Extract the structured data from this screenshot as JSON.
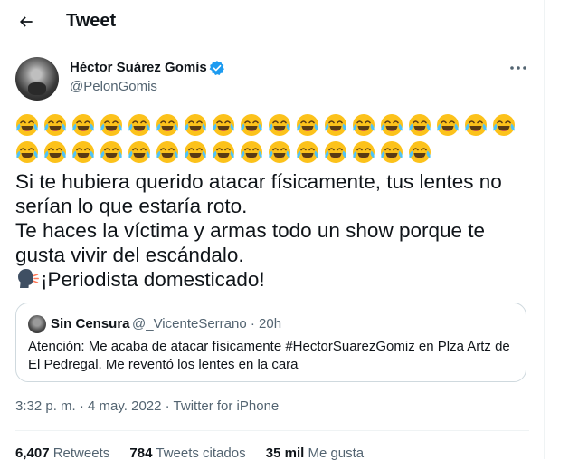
{
  "header": {
    "title": "Tweet",
    "back_icon": "arrow-left-icon"
  },
  "author": {
    "name": "Héctor Suárez Gomís",
    "handle": "@PelonGomis",
    "verified": true,
    "verified_color": "#1d9bf0"
  },
  "tweet": {
    "emoji_row_1_count": 18,
    "emoji_row_2_count": 15,
    "emoji_name": "face-with-tears-of-joy-icon",
    "lines": [
      "Si te hubiera querido atacar físicamente, tus lentes no",
      "serían lo que estaría roto.",
      "Te haces la víctima y armas todo un show porque te",
      "gusta vivir del escándalo.",
      "¡Periodista domesticado!"
    ],
    "line5_icon": "speaking-head-icon"
  },
  "quote": {
    "name": "Sin Censura",
    "meta": "@_VicenteSerrano · 20h",
    "text": "Atención: Me acaba de atacar físicamente #HectorSuarezGomiz en Plza Artz de El Pedregal. Me reventó los lentes en la cara"
  },
  "timestamp": "3:32 p. m. · 4 may. 2022 · Twitter for iPhone",
  "stats": {
    "retweets_count": "6,407",
    "retweets_label": "Retweets",
    "quotes_count": "784",
    "quotes_label": "Tweets citados",
    "likes_count": "35 mil",
    "likes_label": "Me gusta"
  }
}
